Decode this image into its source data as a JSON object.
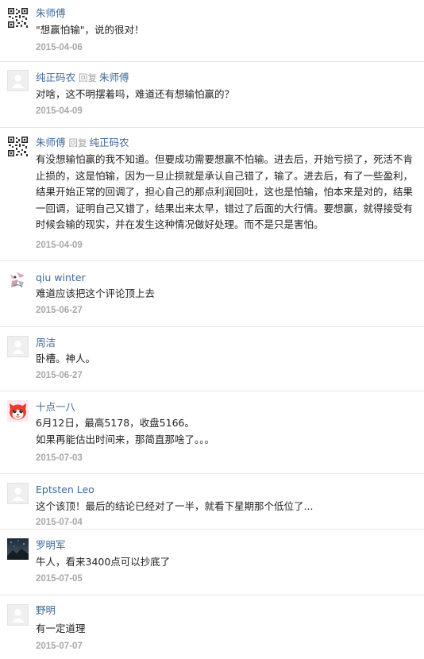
{
  "comments": [
    {
      "author": "朱师傅",
      "reply_word": "",
      "reply_to": "",
      "text": "\"想赢怕输\"，说的很对！",
      "date": "2015-04-06",
      "avatar_icon": "qr-code-avatar"
    },
    {
      "author": "纯正码农",
      "reply_word": "回复",
      "reply_to": "朱师傅",
      "text": "对啥，这不明摆着吗，难道还有想输怕赢的？",
      "date": "2015-04-09",
      "avatar_icon": "default-user-avatar"
    },
    {
      "author": "朱师傅",
      "reply_word": "回复",
      "reply_to": "纯正码农",
      "text": "有没想输怕赢的我不知道。但要成功需要想赢不怕输。进去后，开始亏损了，死活不肯止损的，这是怕输，因为一旦止损就是承认自己错了，输了。进去后，有了一些盈利，结果开始正常的回调了，担心自己的那点利润回吐，这也是怕输，怕本来是对的，结果一回调，证明自己又错了，结果出来太早，错过了后面的大行情。要想赢，就得接受有时候会输的现实，并在发生这种情况做好处理。而不是只是害怕。",
      "date": "2015-04-09",
      "avatar_icon": "qr-code-avatar"
    },
    {
      "author": "qiu winter",
      "reply_word": "",
      "reply_to": "",
      "text": "难道应该把这个评论顶上去",
      "date": "2015-06-27",
      "avatar_icon": "sketch-avatar"
    },
    {
      "author": "周洁",
      "reply_word": "",
      "reply_to": "",
      "text": "卧槽。神人。",
      "date": "2015-06-27",
      "avatar_icon": "default-user-avatar"
    },
    {
      "author": "十点一八",
      "reply_word": "",
      "reply_to": "",
      "text": "6月12日，最高5178，收盘5166。\n如果再能估出时间来，那简直那啥了。。。",
      "date": "2015-07-03",
      "avatar_icon": "cartoon-fox-avatar"
    },
    {
      "author": "Eptsten Leo",
      "reply_word": "",
      "reply_to": "",
      "text": "这个该顶！最后的结论已经对了一半，就看下星期那个低位了...",
      "date": "2015-07-04",
      "avatar_icon": "default-user-avatar"
    },
    {
      "author": "罗明军",
      "reply_word": "",
      "reply_to": "",
      "text": "牛人，看来3400点可以抄底了",
      "date": "2015-07-05",
      "avatar_icon": "night-sky-avatar"
    },
    {
      "author": "野明",
      "reply_word": "",
      "reply_to": "",
      "text": "有一定道理",
      "date": "2015-07-07",
      "avatar_icon": "default-user-avatar"
    }
  ]
}
